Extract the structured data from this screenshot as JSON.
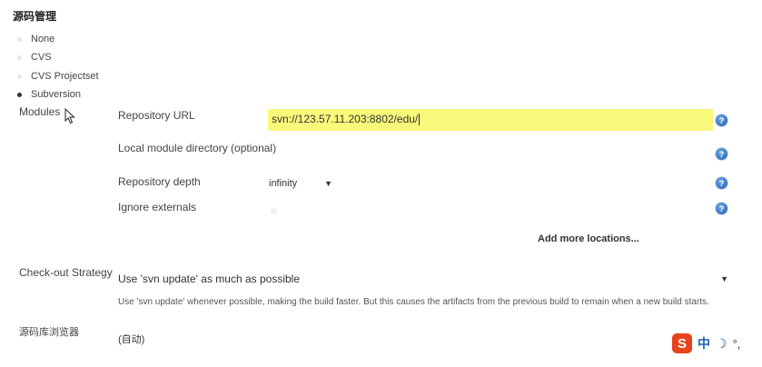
{
  "section": {
    "title": "源码管理"
  },
  "scm_options": [
    {
      "label": "None",
      "selected": false
    },
    {
      "label": "CVS",
      "selected": false
    },
    {
      "label": "CVS Projectset",
      "selected": false
    },
    {
      "label": "Subversion",
      "selected": true
    }
  ],
  "modules": {
    "label": "Modules",
    "repository_url_label": "Repository URL",
    "repository_url_value": "svn://123.57.11.203:8802/edu/",
    "local_dir_label": "Local module directory (optional)",
    "local_dir_value": "",
    "depth_label": "Repository depth",
    "depth_value": "infinity",
    "ignore_externals_label": "Ignore externals",
    "add_more": "Add more locations..."
  },
  "checkout": {
    "label": "Check-out Strategy",
    "value": "Use 'svn update' as much as possible",
    "description": "Use 'svn update' whenever possible, making the build faster. But this causes the artifacts from the previous build to remain when a new build starts."
  },
  "browser": {
    "label": "源码库浏览器",
    "value": "(自动)"
  },
  "ime": {
    "logo": "S",
    "lang": "中",
    "moon": "☽",
    "punct": "°,"
  },
  "icons": {
    "help": "help-icon",
    "cursor": "mouse-cursor-icon",
    "dropdown": "dropdown-arrow-icon"
  },
  "colors": {
    "url_highlight": "#f8f87a",
    "help_blue": "#1f5fae",
    "ime_brand": "#e8431c"
  },
  "glyphs": {
    "help": "?",
    "dropdown": "▼"
  }
}
